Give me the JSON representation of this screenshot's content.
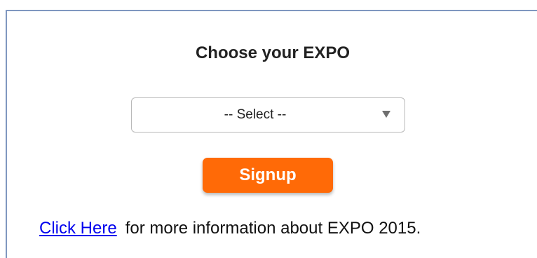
{
  "form": {
    "heading": "Choose your EXPO",
    "select": {
      "selected_label": "-- Select --"
    },
    "signup_label": "Signup"
  },
  "footer": {
    "link_text": "Click Here",
    "trailing_text": "for more information about EXPO 2015."
  },
  "colors": {
    "button": "#ff6a07",
    "link": "#0000ee",
    "panel_border": "#7f97c0"
  }
}
